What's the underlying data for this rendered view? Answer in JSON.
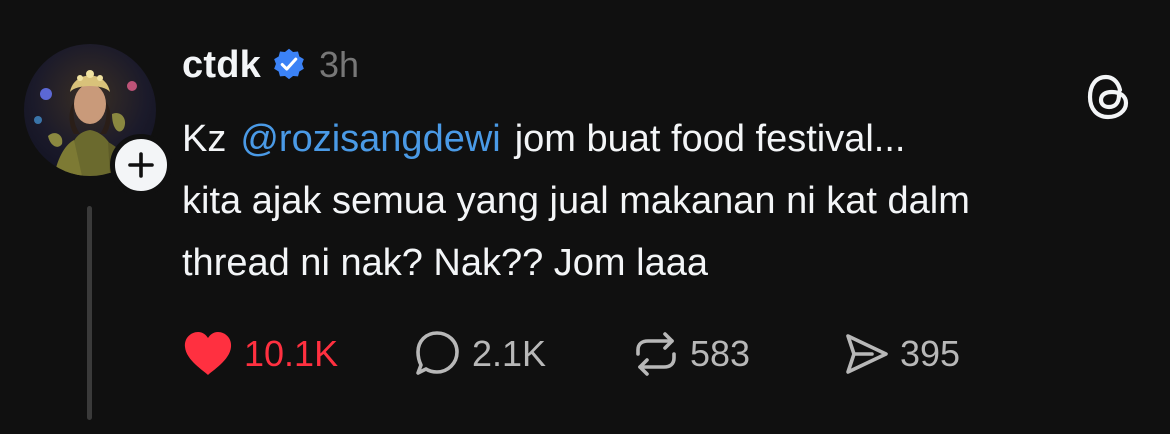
{
  "post": {
    "username": "ctdk",
    "verified": true,
    "timestamp": "3h",
    "text_prefix": "Kz",
    "mention": "@rozisangdewi",
    "text_line1_rest": "jom buat food festival...",
    "text_line2": "kita ajak semua yang jual makanan ni kat dalm",
    "text_line3": "thread ni nak? Nak?? Jom laaa",
    "likes": "10.1K",
    "replies": "2.1K",
    "reposts": "583",
    "shares": "395"
  },
  "colors": {
    "background": "#101010",
    "text": "#f3f5f7",
    "muted": "#777777",
    "mention": "#4a9ae6",
    "like": "#ff3040",
    "verified": "#3b82f6"
  },
  "icons": {
    "avatar": "profile-photo",
    "follow": "plus-icon",
    "verified": "verified-badge-icon",
    "app_logo": "threads-logo-icon",
    "like": "heart-icon",
    "reply": "comment-bubble-icon",
    "repost": "repost-arrows-icon",
    "share": "send-icon"
  }
}
